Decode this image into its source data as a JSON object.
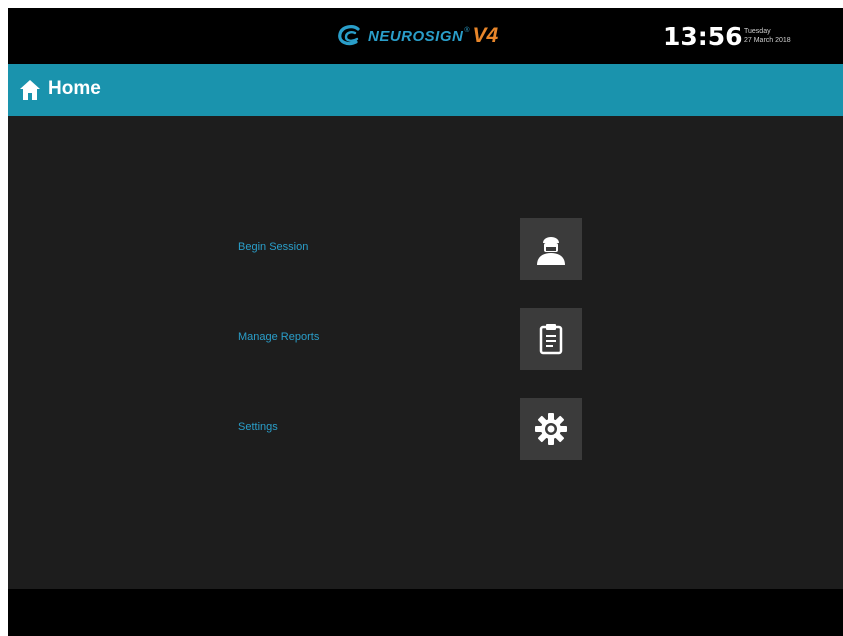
{
  "header": {
    "brand": "NEUROSIGN",
    "trademark": "®",
    "version": "V4",
    "time": "13:56",
    "weekday": "Tuesday",
    "date": "27 March 2018"
  },
  "titlebar": {
    "title": "Home",
    "icon": "home-icon"
  },
  "menu": {
    "items": [
      {
        "label": "Begin Session",
        "icon": "surgeon-icon"
      },
      {
        "label": "Manage Reports",
        "icon": "clipboard-icon"
      },
      {
        "label": "Settings",
        "icon": "gear-icon"
      }
    ]
  },
  "colors": {
    "accent": "#1a93ad",
    "label": "#2a9ec9",
    "version": "#e8862a",
    "background": "#1d1d1d",
    "tile": "#3b3b3b"
  }
}
